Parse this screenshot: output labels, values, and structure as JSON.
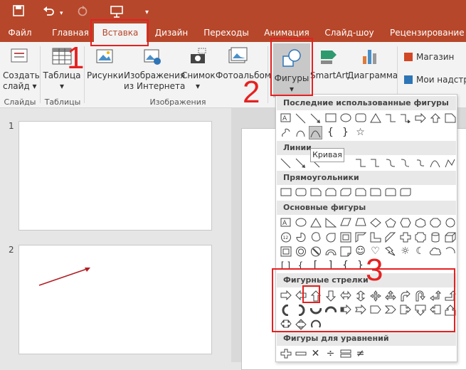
{
  "tabs": [
    {
      "label": "Файл"
    },
    {
      "label": "Главная"
    },
    {
      "label": "Вставка"
    },
    {
      "label": "Дизайн"
    },
    {
      "label": "Переходы"
    },
    {
      "label": "Анимация"
    },
    {
      "label": "Слайд-шоу"
    },
    {
      "label": "Рецензирование"
    }
  ],
  "ribbon": {
    "new_slide": "Создать слайд",
    "new_slide_line1": "Создать",
    "new_slide_line2": "слайд",
    "table": "Таблица",
    "pictures": "Рисунки",
    "online_pictures_line1": "Изображения",
    "online_pictures_line2": "из Интернета",
    "screenshot": "Снимок",
    "photo_album": "Фотоальбом",
    "shapes": "Фигуры",
    "smartart": "SmartArt",
    "chart": "Диаграмма",
    "store": "Магазин",
    "my_addins": "Мои надстро",
    "group_slides": "Слайды",
    "group_tables": "Таблицы",
    "group_images": "Изображения"
  },
  "slides": [
    {
      "num": "1"
    },
    {
      "num": "2"
    }
  ],
  "gallery": {
    "recent": "Последние использованные фигуры",
    "lines": "Линии",
    "rectangles": "Прямоугольники",
    "basic": "Основные фигуры",
    "arrows": "Фигурные стрелки",
    "equations": "Фигуры для уравнений"
  },
  "tooltip": "Кривая",
  "annotations": {
    "n1": "1",
    "n2": "2",
    "n3": "3"
  },
  "colors": {
    "accent": "#b7472a",
    "highlight": "#e52121"
  }
}
